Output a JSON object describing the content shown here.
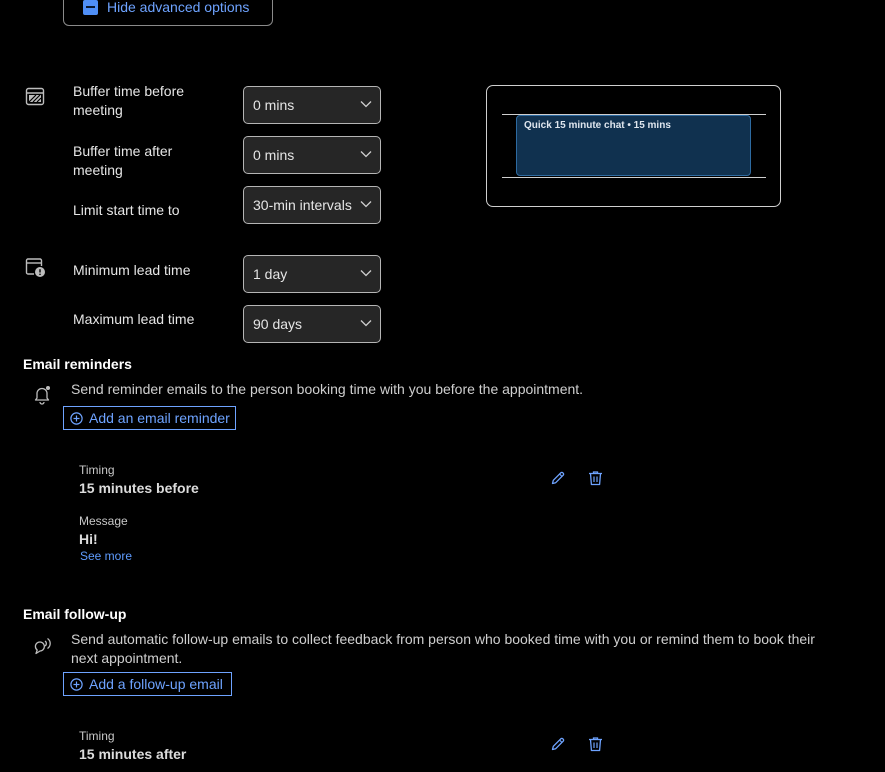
{
  "advanced": {
    "hide_label": "Hide advanced options"
  },
  "buffers": {
    "before": {
      "label_line1": "Buffer time before",
      "label_line2": "meeting",
      "value": "0 mins"
    },
    "after": {
      "label_line1": "Buffer time after",
      "label_line2": "meeting",
      "value": "0 mins"
    },
    "limit": {
      "label": "Limit start time to",
      "value": "30-min intervals"
    }
  },
  "lead": {
    "minimum": {
      "label": "Minimum lead time",
      "value": "1 day"
    },
    "maximum": {
      "label": "Maximum lead time",
      "value": "90 days"
    }
  },
  "preview": {
    "event_text": "Quick 15 minute chat • 15 mins"
  },
  "reminders": {
    "title": "Email reminders",
    "description": "Send reminder emails to the person booking time with you before the appointment.",
    "add_label": "Add an email reminder",
    "item": {
      "timing_label": "Timing",
      "timing_value": "15 minutes before",
      "message_label": "Message",
      "message_value": "Hi!",
      "see_more": "See more"
    }
  },
  "followup": {
    "title": "Email follow-up",
    "description_line1": "Send automatic follow-up emails to collect feedback from person who booked time with you or remind them to book their",
    "description_line2": "next appointment.",
    "add_label": "Add a follow-up email",
    "item": {
      "timing_label": "Timing",
      "timing_value": "15 minutes after"
    }
  },
  "icons": {
    "buffer": "calendar-buffer-icon",
    "lead": "calendar-clock-icon",
    "reminder": "bell-icon",
    "followup": "feedback-icon",
    "edit": "pencil-icon",
    "delete": "trash-icon"
  },
  "colors": {
    "accent": "#6ea3ff",
    "event_fill": "#10314f",
    "background": "#000000"
  }
}
